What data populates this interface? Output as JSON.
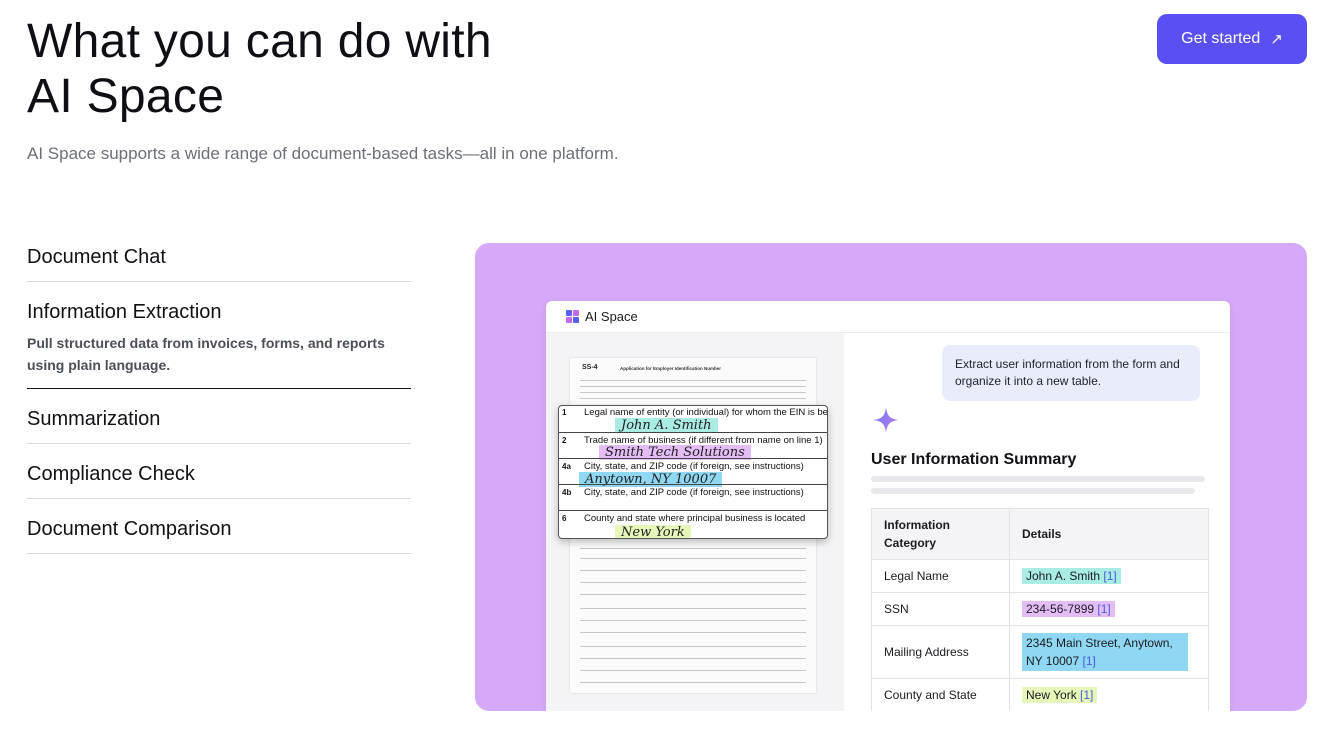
{
  "hero": {
    "title_line1": "What you can do with",
    "title_line2": "AI Space",
    "subtitle": "AI Space supports a wide range of document-based tasks—all in one platform."
  },
  "cta": {
    "label": "Get started",
    "icon": "arrow-up-right-icon",
    "color": "#5a4ff3"
  },
  "features": [
    {
      "title": "Document Chat"
    },
    {
      "title": "Information Extraction",
      "description": "Pull structured data from invoices, forms, and reports using plain language.",
      "active": true
    },
    {
      "title": "Summarization"
    },
    {
      "title": "Compliance Check"
    },
    {
      "title": "Document Comparison"
    }
  ],
  "preview": {
    "background": "#d6a8fa",
    "app_name": "AI Space",
    "form": {
      "code": "SS-4",
      "heading": "Application for Employer Identification Number",
      "rows": [
        {
          "num": "1",
          "label": "Legal name of entity (or individual) for whom the EIN is being r",
          "value": "John A. Smith",
          "color": "#a8ece4"
        },
        {
          "num": "2",
          "label": "Trade name of business (if different from name on line 1)",
          "value": "Smith Tech Solutions",
          "color": "#e4bdf7"
        },
        {
          "num": "4a",
          "label": "City, state, and ZIP code (if foreign, see instructions)",
          "value": "Anytown, NY 10007",
          "color": "#8fd7f2"
        },
        {
          "num": "4b",
          "label": "City, state, and ZIP code (if foreign, see instructions)",
          "value": ""
        },
        {
          "num": "6",
          "label": "County and state where principal business is located",
          "value": "New York",
          "color": "#e5f7b9"
        }
      ]
    },
    "chat": {
      "prompt": "Extract user information from the form and organize it into a new table.",
      "summary_title": "User Information Summary",
      "table": {
        "headers": [
          "Information Category",
          "Details"
        ],
        "rows": [
          {
            "category": "Legal Name",
            "value": "John A. Smith",
            "ref": "[1]",
            "color": "#a8ece4"
          },
          {
            "category": "SSN",
            "value": "234-56-7899",
            "ref": "[1]",
            "color": "#e4bdf7"
          },
          {
            "category": "Mailing Address",
            "value": "2345 Main Street, Anytown, NY 10007",
            "ref": "[1]",
            "color": "#8fd7f2"
          },
          {
            "category": "County and State",
            "value": "New York",
            "ref": "[1]",
            "color": "#e5f7b9"
          }
        ]
      }
    }
  }
}
